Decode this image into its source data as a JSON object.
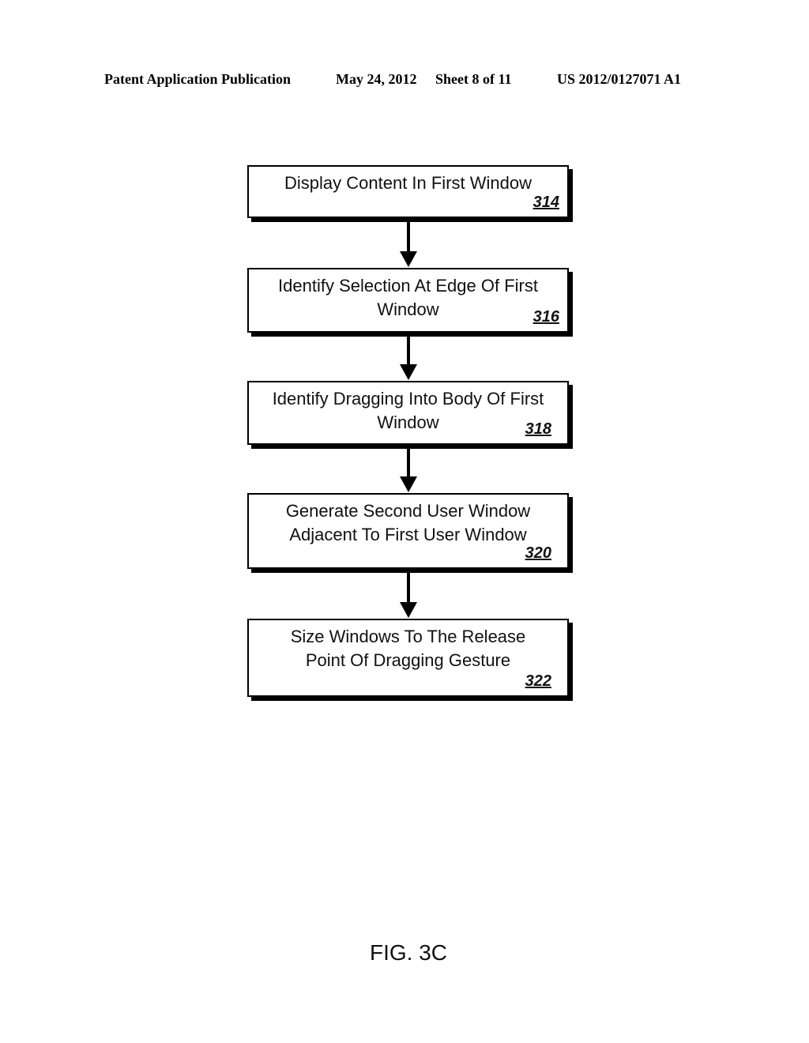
{
  "header": {
    "publication": "Patent Application Publication",
    "date": "May 24, 2012",
    "sheet": "Sheet 8 of 11",
    "number": "US 2012/0127071 A1"
  },
  "flowchart": {
    "steps": [
      {
        "text": "Display Content In First Window",
        "ref": "314"
      },
      {
        "text": "Identify Selection At Edge Of First Window",
        "ref": "316"
      },
      {
        "text": "Identify Dragging Into Body Of First Window",
        "ref": "318"
      },
      {
        "text": "Generate Second User Window Adjacent To First User Window",
        "ref": "320"
      },
      {
        "text": "Size Windows To The Release Point Of Dragging Gesture",
        "ref": "322"
      }
    ]
  },
  "figure_label": "FIG. 3C"
}
